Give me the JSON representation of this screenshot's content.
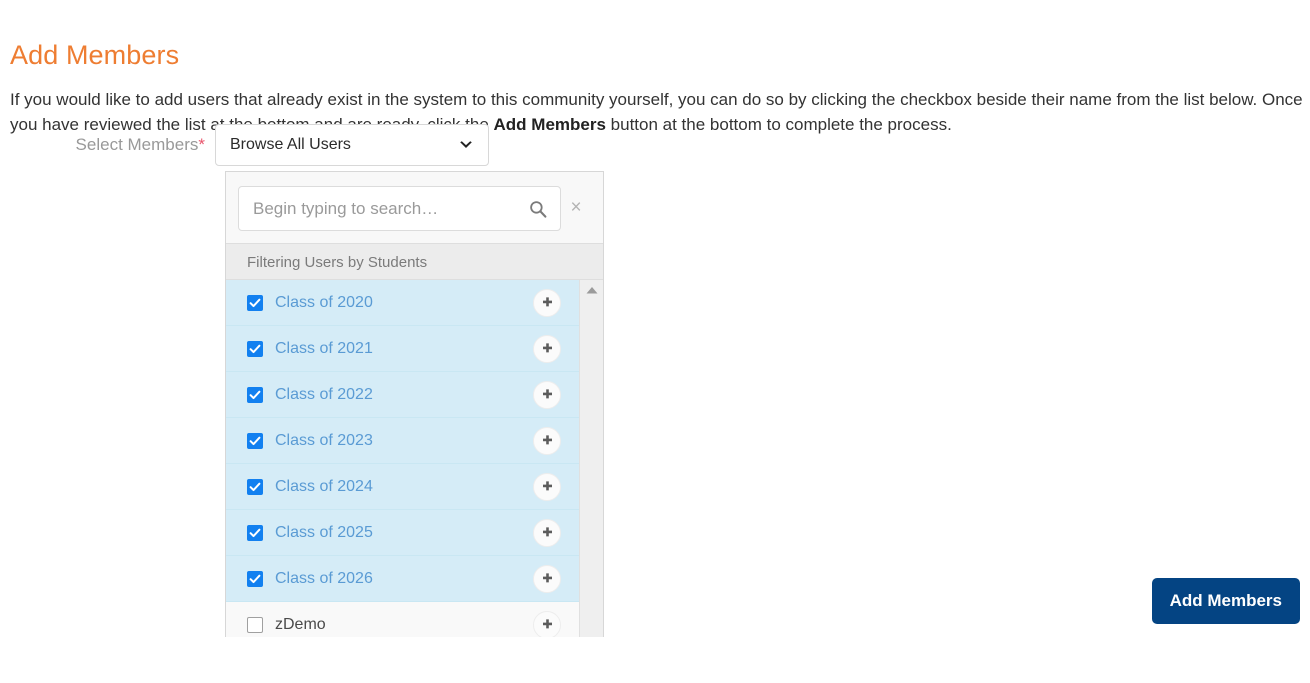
{
  "page": {
    "title": "Add Members",
    "intro_part1": "If you would like to add users that already exist in the system to this community yourself, you can do so by clicking the checkbox beside their name from the list below. Once you have reviewed the list at the bottom and are ready, click the ",
    "intro_bold": "Add Members",
    "intro_part2": " button at the bottom to complete the process.",
    "title_color": "#ee7d32"
  },
  "field": {
    "label": "Select Members",
    "required_marker": "*",
    "select_value": "Browse All Users",
    "caret_icon": "chevron-down-icon"
  },
  "dropdown": {
    "search_placeholder": "Begin typing to search…",
    "search_value": "",
    "search_icon": "search-icon",
    "close_label": "×",
    "close_icon": "close-icon",
    "filter_header": "Filtering Users by Students",
    "add_icon": "plus-icon",
    "scroll_up_icon": "chevron-up-icon",
    "rows": [
      {
        "label": "Class of 2020",
        "checked": true
      },
      {
        "label": "Class of 2021",
        "checked": true
      },
      {
        "label": "Class of 2022",
        "checked": true
      },
      {
        "label": "Class of 2023",
        "checked": true
      },
      {
        "label": "Class of 2024",
        "checked": true
      },
      {
        "label": "Class of 2025",
        "checked": true
      },
      {
        "label": "Class of 2026",
        "checked": true
      },
      {
        "label": "zDemo",
        "checked": false
      }
    ]
  },
  "submit": {
    "label": "Add Members",
    "color": "#044483"
  }
}
